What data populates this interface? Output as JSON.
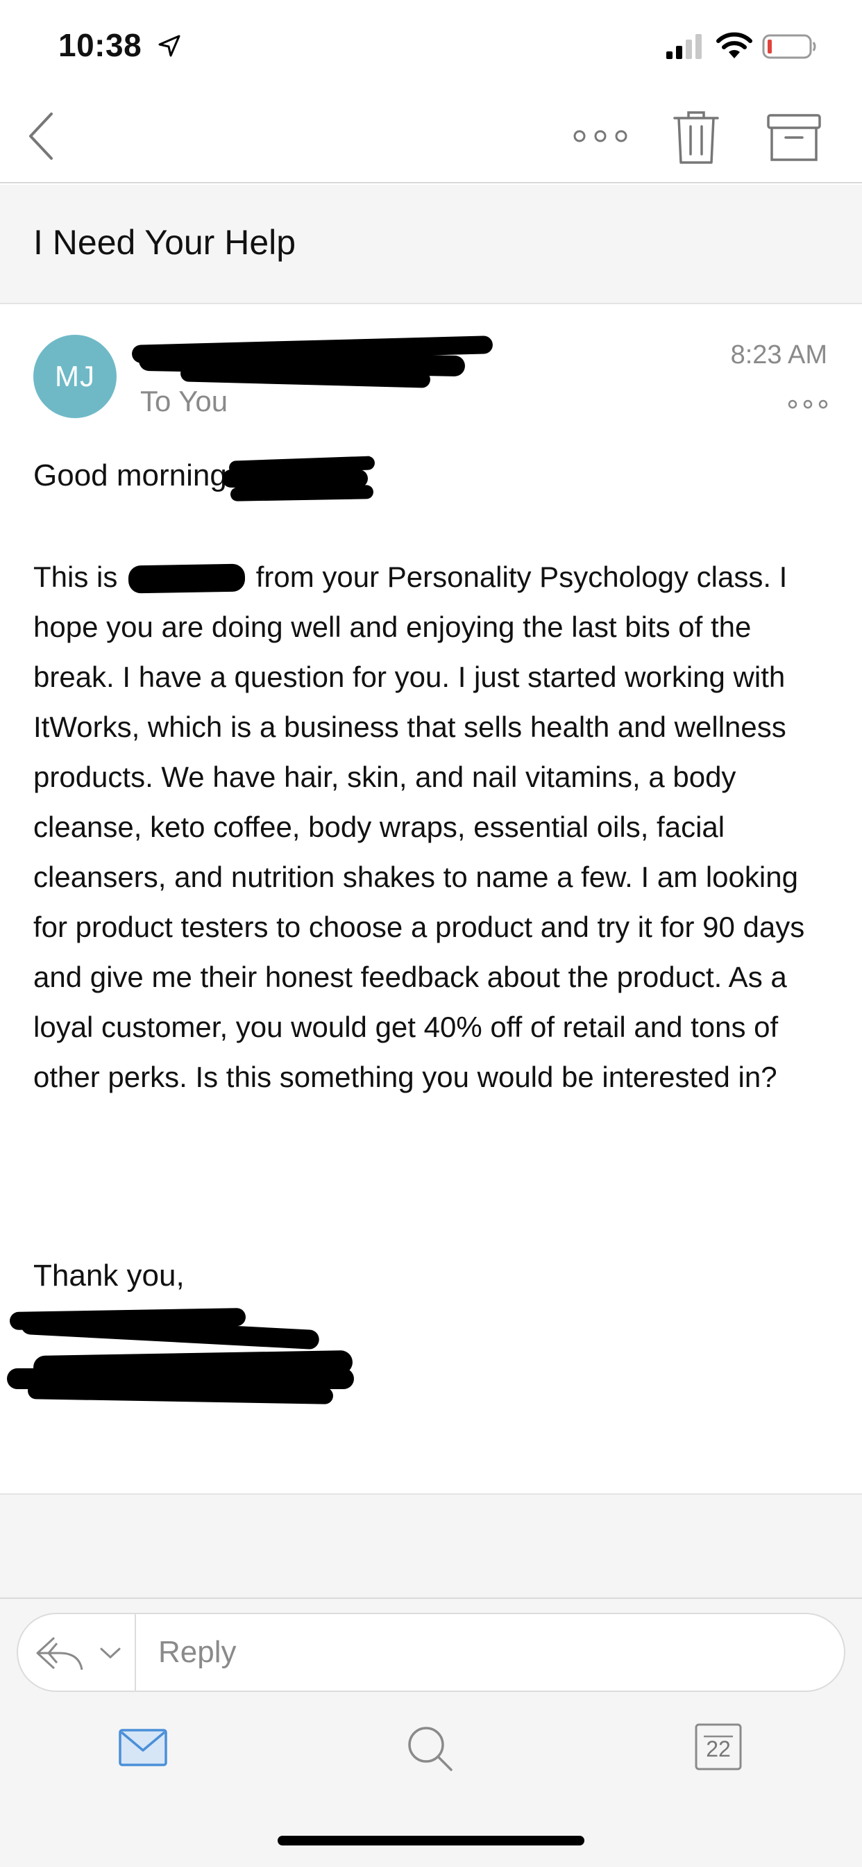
{
  "status": {
    "time": "10:38",
    "icons": [
      "location-arrow-icon",
      "signal-icon",
      "wifi-icon",
      "battery-icon"
    ],
    "battery_color": "#e0433b"
  },
  "nav": {
    "icons": [
      "back-chevron-icon",
      "more-dots-icon",
      "trash-icon",
      "archive-icon"
    ]
  },
  "email": {
    "subject": "I Need Your Help",
    "avatar_initials": "MJ",
    "avatar_color": "#6fb9c7",
    "to": "To You",
    "time": "8:23 AM",
    "greeting": "Good morning",
    "body_before_redaction": "This is",
    "body_after_redaction": "from your Personality Psychology class. I hope you are doing well and enjoying the last bits of the break. I have a question for you. I just started working with ItWorks, which is a business that sells health and wellness products. We have hair, skin, and nail vitamins, a body cleanse, keto coffee, body wraps, essential oils, facial cleansers, and nutrition shakes to name a few. I am looking for product testers to choose a product and try it for 90 days and give me their honest feedback about the product. As a loyal customer, you would get 40% off of retail and tons of other perks. Is this something you would be interested in?",
    "signoff": "Thank you,"
  },
  "reply": {
    "placeholder": "Reply"
  },
  "tabs": {
    "calendar_day": "22",
    "accent": "#4a8fd8"
  }
}
